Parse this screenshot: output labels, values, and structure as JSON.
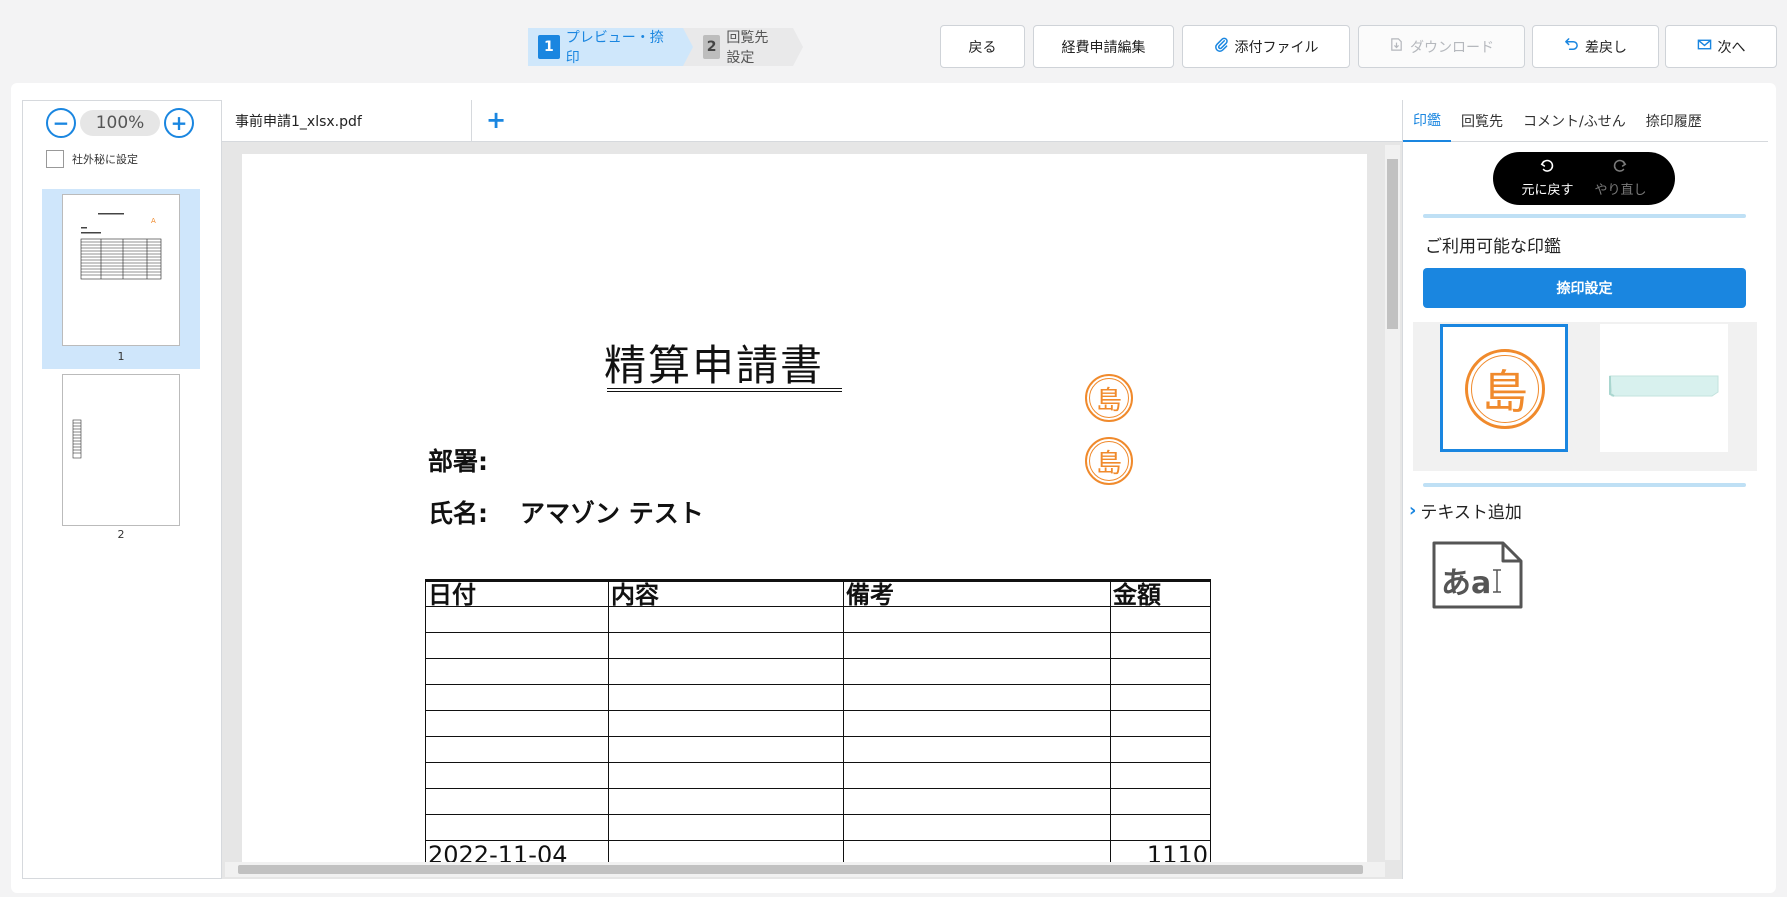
{
  "steps": [
    {
      "num": "1",
      "label": "プレビュー・捺印"
    },
    {
      "num": "2",
      "label": "回覧先設定"
    }
  ],
  "toolbar": {
    "back": "戻る",
    "edit": "経費申請編集",
    "attach": "添付ファイル",
    "download": "ダウンロード",
    "sendback": "差戻し",
    "next": "次へ"
  },
  "left": {
    "zoom": "100%",
    "secret_label": "社外秘に設定",
    "pages": [
      "1",
      "2"
    ]
  },
  "document": {
    "tab_name": "事前申請1_xlsx.pdf",
    "title": "精算申請書",
    "department_label": "部署:",
    "name_label": "氏名:",
    "name_value": "アマゾン テスト",
    "stamp_char": "島",
    "table_headers": [
      "日付",
      "内容",
      "備考",
      "金額"
    ],
    "last_row": {
      "date": "2022-11-04",
      "amount": "1110"
    }
  },
  "right": {
    "tabs": [
      "印鑑",
      "回覧先",
      "コメント/ふせん",
      "捺印履歴"
    ],
    "undo": "元に戻す",
    "redo": "やり直し",
    "available_stamps": "ご利用可能な印鑑",
    "stamp_settings": "捺印設定",
    "stamp_char": "島",
    "text_add": "テキスト追加",
    "text_icon_label": "あa"
  },
  "colors": {
    "accent": "#1a86e0",
    "stamp": "#f08a2c"
  }
}
